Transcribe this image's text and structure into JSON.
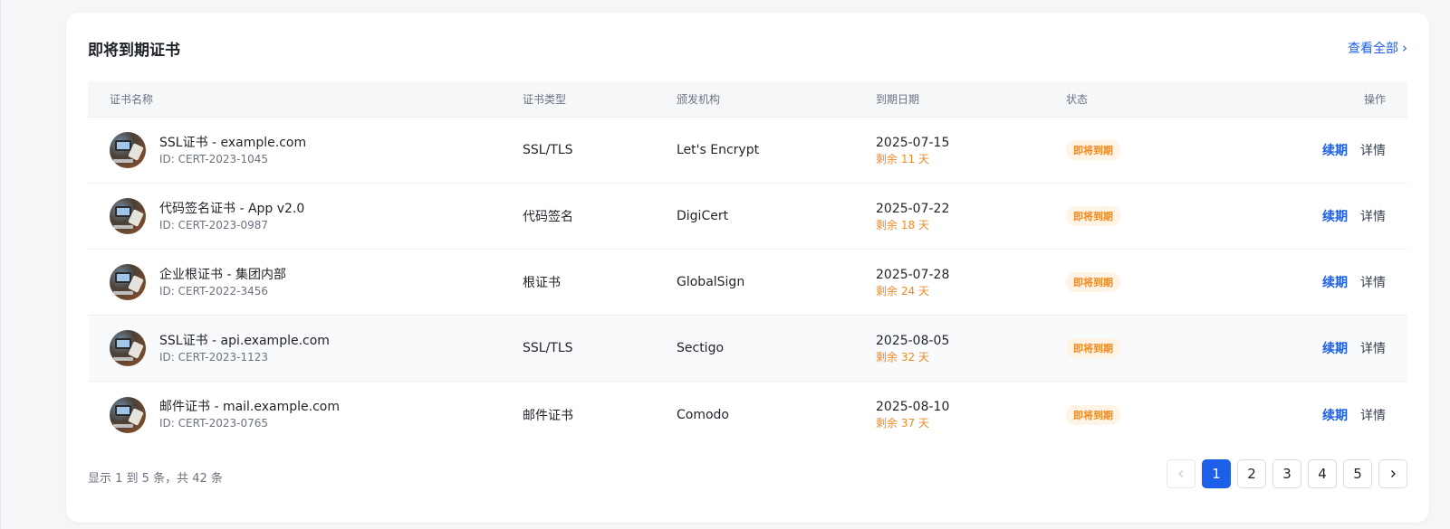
{
  "card": {
    "title": "即将到期证书",
    "view_all": "查看全部"
  },
  "table": {
    "headers": {
      "name": "证书名称",
      "type": "证书类型",
      "issuer": "颁发机构",
      "expiry": "到期日期",
      "status": "状态",
      "actions": "操作"
    },
    "rows": [
      {
        "name": "SSL证书 - example.com",
        "id": "ID: CERT-2023-1045",
        "type": "SSL/TLS",
        "issuer": "Let's Encrypt",
        "date": "2025-07-15",
        "remaining": "剩余 11 天",
        "status": "即将到期",
        "renew": "续期",
        "detail": "详情"
      },
      {
        "name": "代码签名证书 - App v2.0",
        "id": "ID: CERT-2023-0987",
        "type": "代码签名",
        "issuer": "DigiCert",
        "date": "2025-07-22",
        "remaining": "剩余 18 天",
        "status": "即将到期",
        "renew": "续期",
        "detail": "详情"
      },
      {
        "name": "企业根证书 - 集团内部",
        "id": "ID: CERT-2022-3456",
        "type": "根证书",
        "issuer": "GlobalSign",
        "date": "2025-07-28",
        "remaining": "剩余 24 天",
        "status": "即将到期",
        "renew": "续期",
        "detail": "详情"
      },
      {
        "name": "SSL证书 - api.example.com",
        "id": "ID: CERT-2023-1123",
        "type": "SSL/TLS",
        "issuer": "Sectigo",
        "date": "2025-08-05",
        "remaining": "剩余 32 天",
        "status": "即将到期",
        "renew": "续期",
        "detail": "详情"
      },
      {
        "name": "邮件证书 - mail.example.com",
        "id": "ID: CERT-2023-0765",
        "type": "邮件证书",
        "issuer": "Comodo",
        "date": "2025-08-10",
        "remaining": "剩余 37 天",
        "status": "即将到期",
        "renew": "续期",
        "detail": "详情"
      }
    ]
  },
  "footer": {
    "info": "显示 1 到 5 条，共 42 条",
    "pages": [
      "1",
      "2",
      "3",
      "4",
      "5"
    ],
    "active_page": "1"
  },
  "colors": {
    "accent": "#1d5fe8",
    "warning": "#f08a24",
    "warning_bg": "#fff4e5"
  },
  "icons": {
    "view_all": "chevron-right-icon",
    "prev": "chevron-left-icon",
    "next": "chevron-right-icon",
    "avatar": "certificate-thumbnail"
  }
}
